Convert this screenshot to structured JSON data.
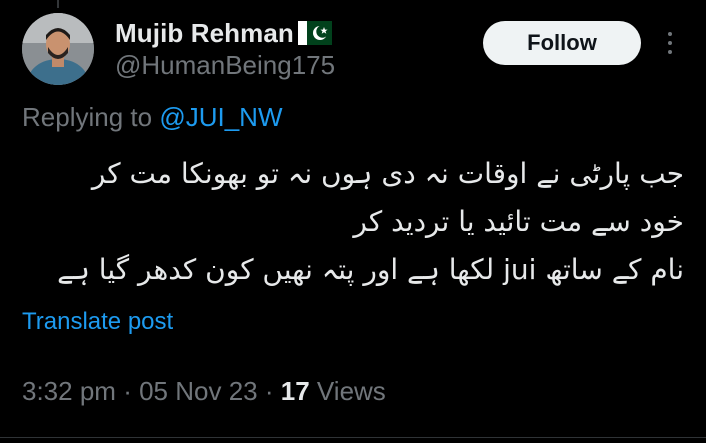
{
  "author": {
    "display_name": "Mujib Rehman",
    "flag_icon": "pakistan-flag-icon",
    "handle": "@HumanBeing175"
  },
  "follow_label": "Follow",
  "reply_context": {
    "prefix": "Replying to",
    "mention": "@JUI_NW"
  },
  "tweet_lines": [
    "جب پارٹی نے اوقات نہ دی ہوں نہ تو  بھونکا مت کر",
    "خود سے مت تائید یا تردید کر",
    "نام کے ساتھ jui لکھا ہے اور پتہ نھیں کون کدھر گیا ہے"
  ],
  "translate_label": "Translate post",
  "meta": {
    "time": "3:32 pm",
    "sep1": "·",
    "date": "05 Nov 23",
    "sep2": "·",
    "views_count": "17",
    "views_label": "Views"
  },
  "colors": {
    "background": "#000000",
    "text": "#e7e9ea",
    "secondary": "#71767b",
    "link": "#1d9bf0",
    "button_bg": "#eff3f4"
  }
}
